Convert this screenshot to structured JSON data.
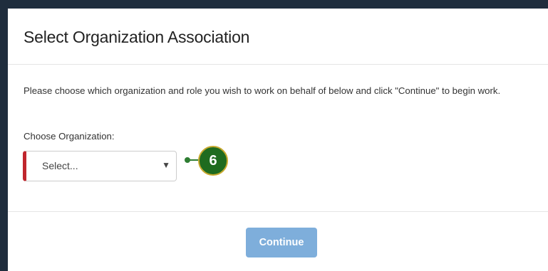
{
  "modal": {
    "title": "Select Organization Association",
    "instructions": "Please choose which organization and role you wish to work on behalf of below and click \"Continue\" to begin work.",
    "organization_field": {
      "label": "Choose Organization:",
      "selected_value": "Select...",
      "arrow_glyph": "▼",
      "required_indicator_color": "#c0262d"
    },
    "continue_button": {
      "label": "Continue",
      "color": "#7eaedb",
      "state": "disabled"
    }
  },
  "callout": {
    "step_number": "6",
    "color": "#1f6b1f",
    "ring_color": "#c7a92f"
  }
}
